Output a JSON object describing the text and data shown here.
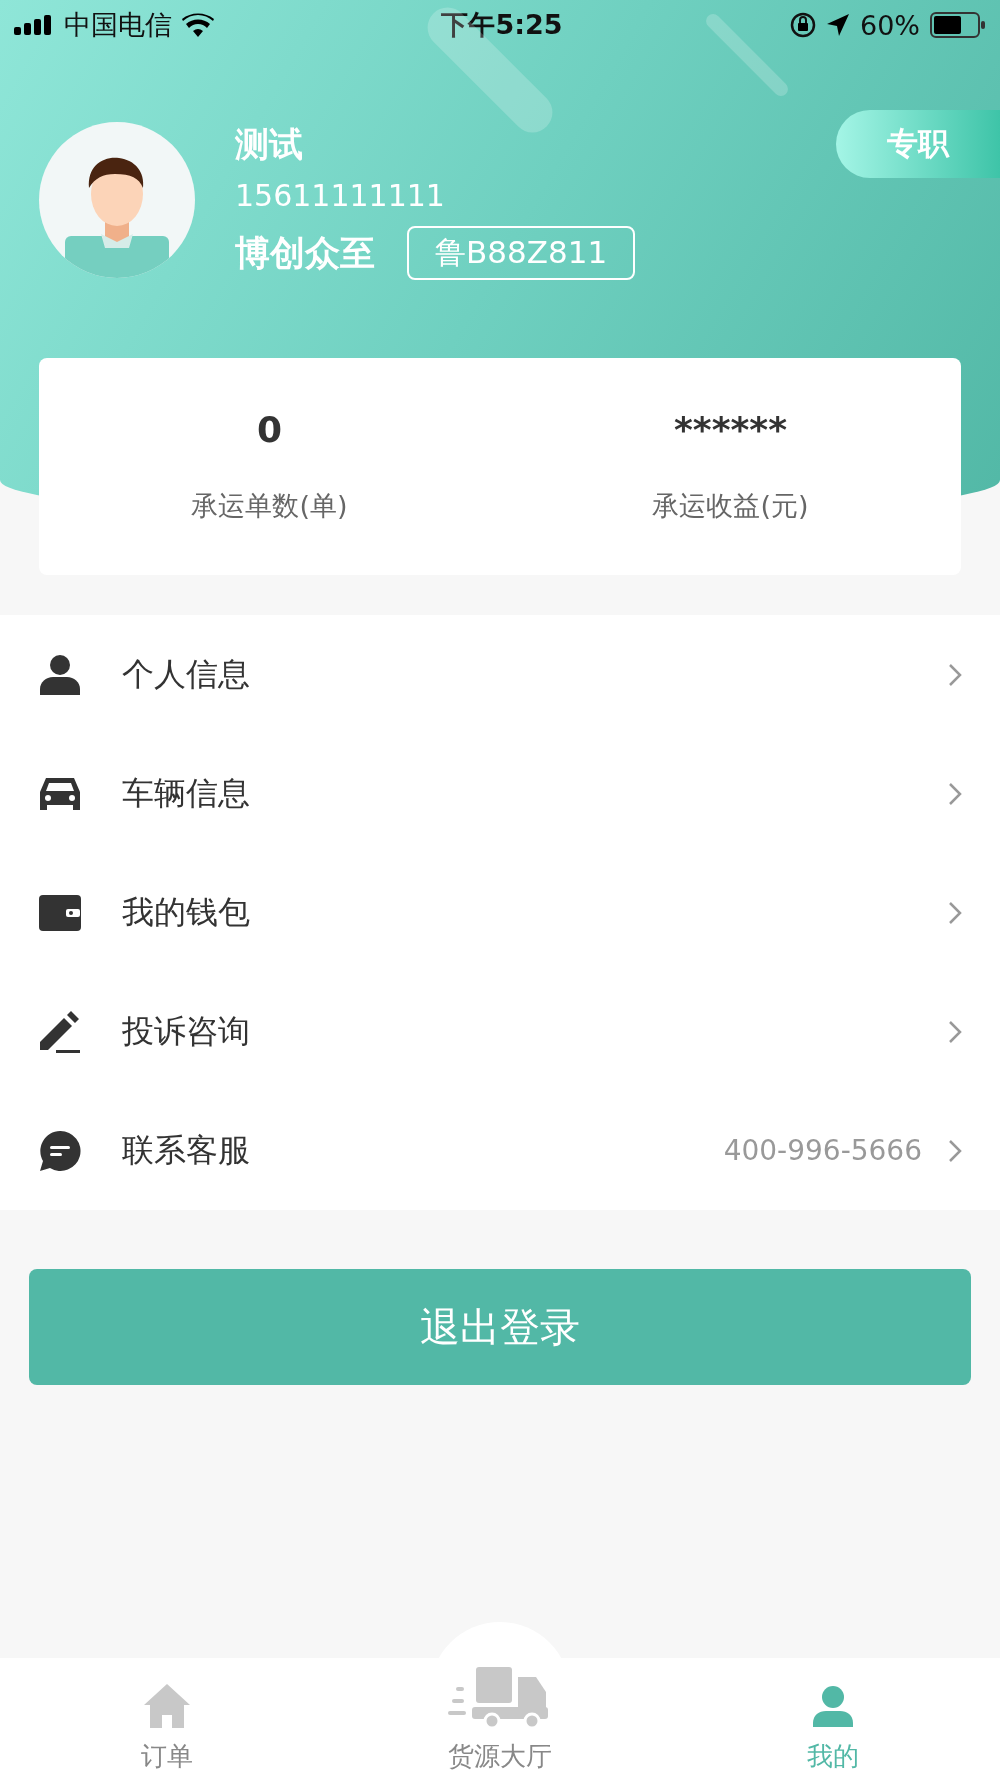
{
  "status_bar": {
    "carrier": "中国电信",
    "time": "下午5:25",
    "battery": "60%"
  },
  "profile": {
    "name": "测试",
    "phone": "15611111111",
    "company": "博创众至",
    "plate": "鲁B88Z811",
    "role_badge": "专职"
  },
  "stats": [
    {
      "value": "0",
      "label": "承运单数(单)"
    },
    {
      "value": "******",
      "label": "承运收益(元)"
    }
  ],
  "menu": [
    {
      "kind": "person",
      "label": "个人信息"
    },
    {
      "kind": "car",
      "label": "车辆信息"
    },
    {
      "kind": "wallet",
      "label": "我的钱包"
    },
    {
      "kind": "edit",
      "label": "投诉咨询"
    },
    {
      "kind": "chat",
      "label": "联系客服",
      "value": "400-996-5666"
    }
  ],
  "logout_button": "退出登录",
  "tab_bar": [
    {
      "kind": "home",
      "label": "订单",
      "selected": false
    },
    {
      "kind": "truck",
      "label": "货源大厅",
      "selected": false
    },
    {
      "kind": "person",
      "label": "我的",
      "selected": true
    }
  ]
}
